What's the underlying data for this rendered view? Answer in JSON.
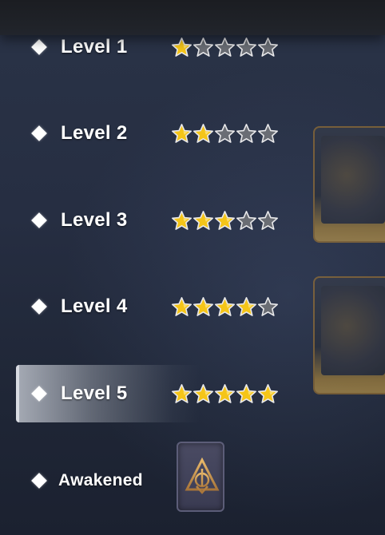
{
  "levels": [
    {
      "label": "Level 1",
      "stars": 1,
      "max_stars": 5
    },
    {
      "label": "Level 2",
      "stars": 2,
      "max_stars": 5
    },
    {
      "label": "Level 3",
      "stars": 3,
      "max_stars": 5
    },
    {
      "label": "Level 4",
      "stars": 4,
      "max_stars": 5
    },
    {
      "label": "Level 5",
      "stars": 5,
      "max_stars": 5
    }
  ],
  "selected_level": "Level 5",
  "awakened": {
    "label": "Awakened",
    "icon": "awakening-triangle-emblem-icon"
  },
  "colors": {
    "star_filled": "#f5c518",
    "star_empty": "#6a6d74",
    "star_outline": "#e8e8ea",
    "card_gold": "#c99a3a"
  }
}
